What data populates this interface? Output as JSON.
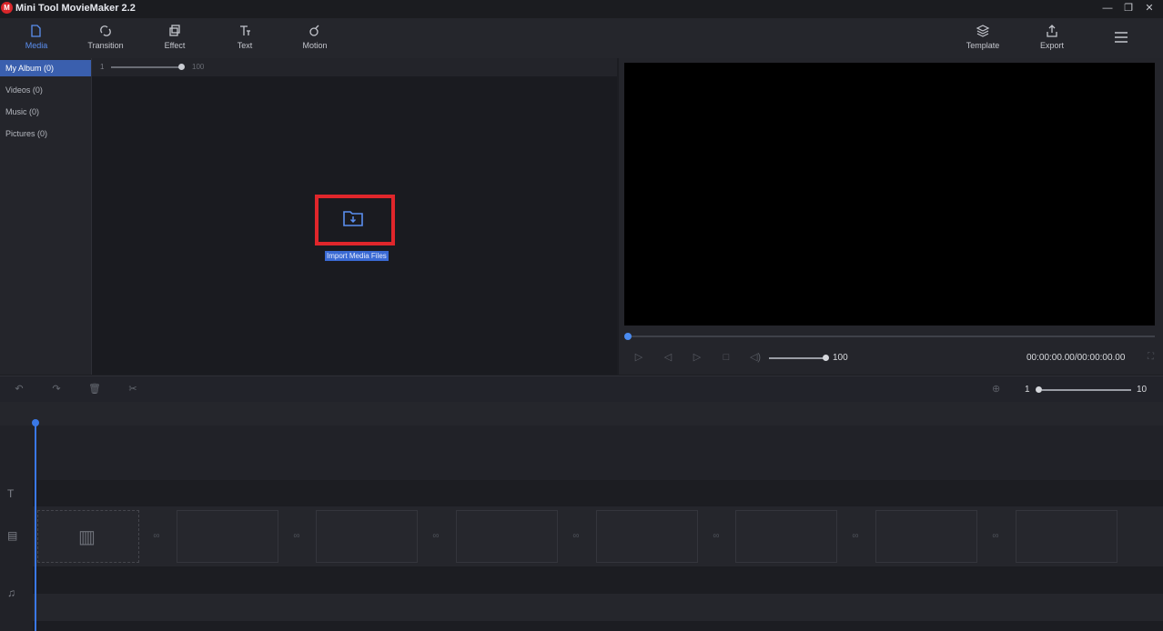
{
  "window": {
    "logo_text": "M",
    "title": "Mini Tool MovieMaker 2.2",
    "minimize": "—",
    "restore": "❐",
    "close": "✕"
  },
  "toolbar": {
    "left": [
      {
        "label": "Media",
        "icon": "folder-icon",
        "active": true
      },
      {
        "label": "Transition",
        "icon": "transition-icon"
      },
      {
        "label": "Effect",
        "icon": "effect-icon"
      },
      {
        "label": "Text",
        "icon": "text-icon"
      },
      {
        "label": "Motion",
        "icon": "motion-icon"
      }
    ],
    "right": [
      {
        "label": "Template",
        "icon": "template-icon"
      },
      {
        "label": "Export",
        "icon": "export-icon"
      }
    ],
    "menu_icon": "hamburger-menu-icon"
  },
  "sidebar": {
    "items": [
      {
        "label": "My Album (0)",
        "active": true
      },
      {
        "label": "Videos (0)"
      },
      {
        "label": "Music (0)"
      },
      {
        "label": "Pictures (0)"
      }
    ]
  },
  "media": {
    "zoom_min": "1",
    "zoom_max": "100",
    "import_label": "Import Media Files"
  },
  "player": {
    "volume": "100",
    "timecode": "00:00:00.00/00:00:00.00",
    "progress": 0
  },
  "timeline": {
    "zoom_min": "1",
    "zoom_max": "10",
    "zoom_value": 1
  },
  "colors": {
    "accent": "#3a6ad4",
    "highlight_border": "#e0262b",
    "playhead": "#3a78e6"
  }
}
